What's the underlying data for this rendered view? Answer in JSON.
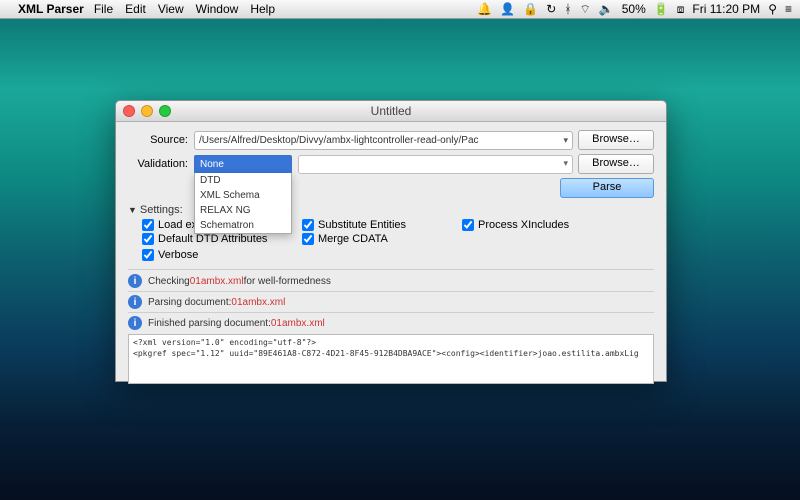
{
  "menubar": {
    "apple": "",
    "app": "XML Parser",
    "items": [
      "File",
      "Edit",
      "View",
      "Window",
      "Help"
    ],
    "right": {
      "battery": "50%",
      "clock": "Fri 11:20 PM"
    }
  },
  "window": {
    "title": "Untitled",
    "source_label": "Source:",
    "source_value": "/Users/Alfred/Desktop/Divvy/ambx-lightcontroller-read-only/Pac",
    "browse": "Browse…",
    "validation_label": "Validation:",
    "validation_selected": "None",
    "validation_options": [
      "DTD",
      "XML Schema",
      "RELAX NG",
      "Schematron"
    ],
    "parse": "Parse",
    "settings_label": "Settings:",
    "checks": {
      "load_dtd": "Load external DTD",
      "default_attrs": "Default DTD Attributes",
      "sub_entities": "Substitute Entities",
      "merge_cdata": "Merge CDATA",
      "proc_xinc": "Process XIncludes",
      "verbose": "Verbose"
    },
    "log": {
      "checking_prefix": "Checking ",
      "checking_file": "01ambx.xml",
      "checking_suffix": " for well-formedness",
      "parsing_prefix": "Parsing document: ",
      "parsing_file": "01ambx.xml",
      "finished_prefix": "Finished parsing document: ",
      "finished_file": "01ambx.xml"
    },
    "output": {
      "line1": "<?xml version=\"1.0\" encoding=\"utf-8\"?>",
      "line2": "<pkgref spec=\"1.12\" uuid=\"89E461A8-C872-4D21-8F45-912B4DBA9ACE\"><config><identifier>joao.estilita.ambxLig"
    }
  }
}
